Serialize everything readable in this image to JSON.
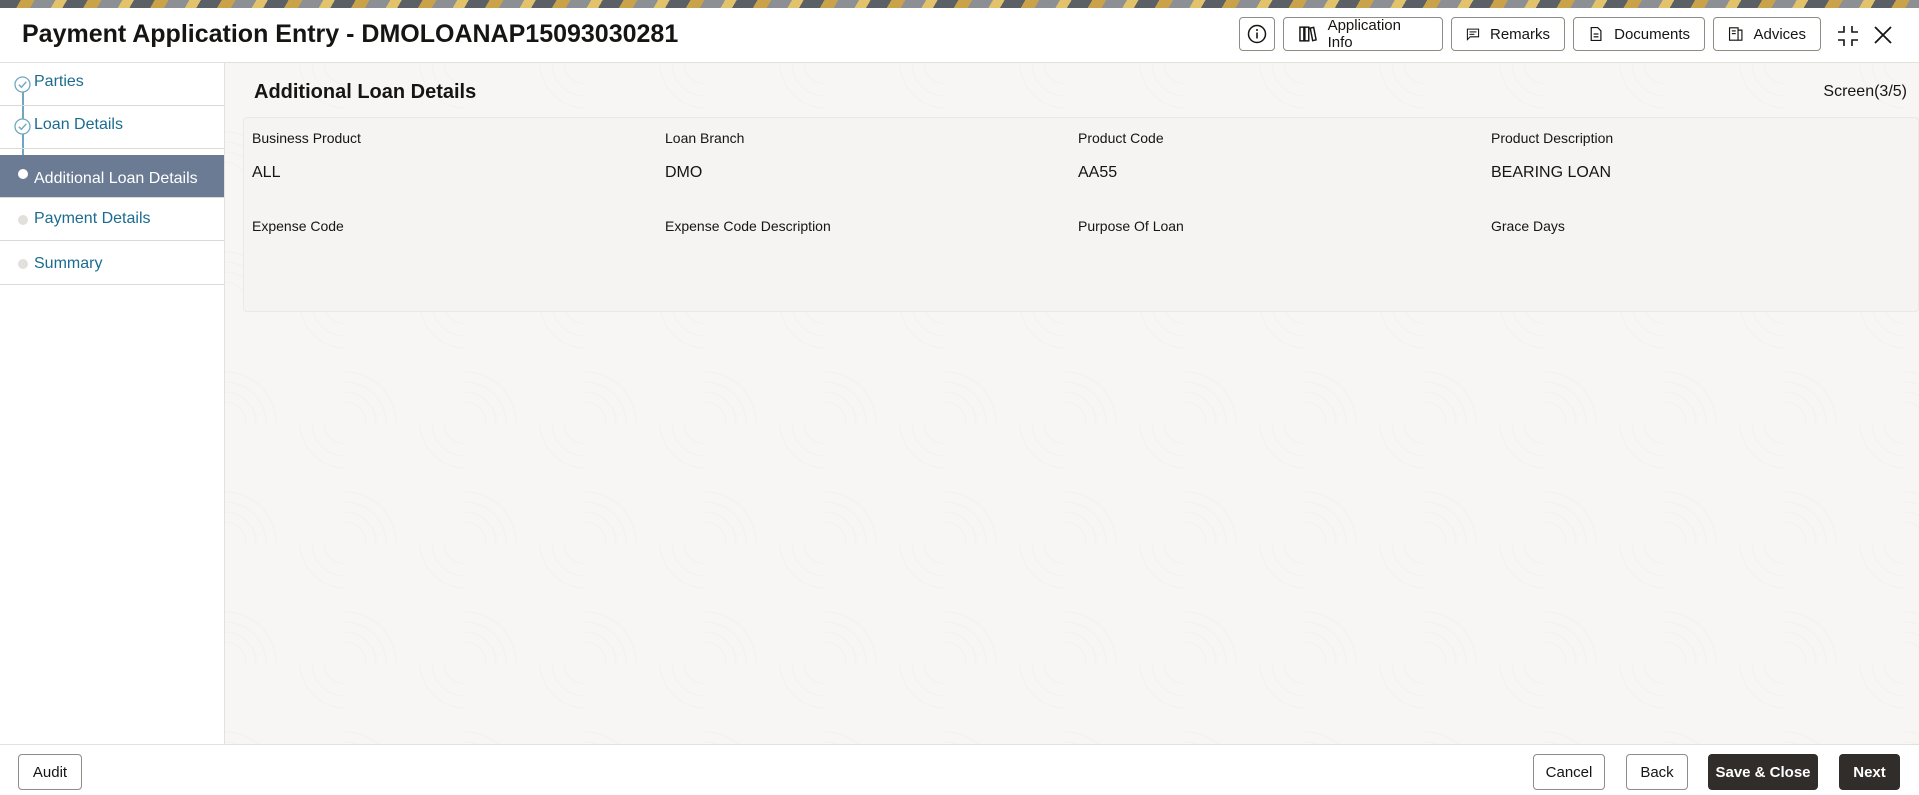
{
  "header": {
    "title": "Payment Application Entry - DMOLOANAP15093030281",
    "buttons": {
      "application_info": "Application Info",
      "remarks": "Remarks",
      "documents": "Documents",
      "advices": "Advices"
    },
    "icons": [
      "info-icon",
      "application-info-icon",
      "remarks-icon",
      "documents-icon",
      "advices-icon",
      "maximize-icon",
      "close-icon"
    ]
  },
  "sidebar": {
    "steps": [
      {
        "label": "Parties",
        "state": "completed"
      },
      {
        "label": "Loan Details",
        "state": "completed"
      },
      {
        "label": "Additional Loan Details",
        "state": "active"
      },
      {
        "label": "Payment Details",
        "state": "pending"
      },
      {
        "label": "Summary",
        "state": "pending"
      }
    ]
  },
  "main": {
    "section_title": "Additional Loan Details",
    "screen_indicator": "Screen(3/5)",
    "fields": [
      {
        "label": "Business Product",
        "value": "ALL"
      },
      {
        "label": "Loan Branch",
        "value": "DMO"
      },
      {
        "label": "Product Code",
        "value": "AA55"
      },
      {
        "label": "Product Description",
        "value": "BEARING LOAN"
      },
      {
        "label": "Expense Code",
        "value": ""
      },
      {
        "label": "Expense Code Description",
        "value": ""
      },
      {
        "label": "Purpose Of Loan",
        "value": ""
      },
      {
        "label": "Grace Days",
        "value": ""
      }
    ]
  },
  "footer": {
    "audit": "Audit",
    "cancel": "Cancel",
    "back": "Back",
    "save_close": "Save & Close",
    "next": "Next"
  },
  "colors": {
    "active_step_bg": "#6b7b94",
    "link_text": "#1b6c8f",
    "primary_button": "#312d2a"
  }
}
